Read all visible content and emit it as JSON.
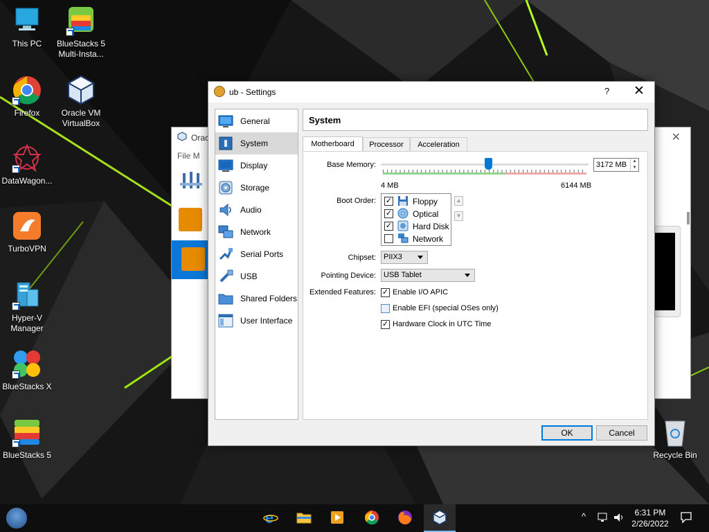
{
  "desktop": {
    "icons": [
      {
        "label": "This PC"
      },
      {
        "label": "BlueStacks 5 Multi-Insta..."
      },
      {
        "label": "Firefox"
      },
      {
        "label": "Oracle VM VirtualBox"
      },
      {
        "label": "DataWagon..."
      },
      {
        "label": "TurboVPN"
      },
      {
        "label": "Hyper-V Manager"
      },
      {
        "label": "BlueStacks X"
      },
      {
        "label": "BlueStacks 5"
      },
      {
        "label": "Recycle Bin"
      }
    ]
  },
  "manager": {
    "title": "Orac",
    "menu": "File   M"
  },
  "dialog": {
    "title": "ub - Settings",
    "help": "?",
    "close": "✕",
    "sidebar": [
      {
        "label": "General",
        "icon": "general-icon"
      },
      {
        "label": "System",
        "icon": "system-icon",
        "selected": true
      },
      {
        "label": "Display",
        "icon": "display-icon"
      },
      {
        "label": "Storage",
        "icon": "storage-icon"
      },
      {
        "label": "Audio",
        "icon": "audio-icon"
      },
      {
        "label": "Network",
        "icon": "network-icon"
      },
      {
        "label": "Serial Ports",
        "icon": "serial-ports-icon"
      },
      {
        "label": "USB",
        "icon": "usb-icon"
      },
      {
        "label": "Shared Folders",
        "icon": "shared-folders-icon"
      },
      {
        "label": "User Interface",
        "icon": "user-interface-icon"
      }
    ],
    "section_title": "System",
    "tabs": [
      {
        "label": "Motherboard",
        "active": true
      },
      {
        "label": "Processor"
      },
      {
        "label": "Acceleration"
      }
    ],
    "motherboard": {
      "base_memory_label": "Base Memory:",
      "base_memory_value": "3172 MB",
      "base_memory_mb": 3172,
      "memory_min_label": "4 MB",
      "memory_max_label": "6144 MB",
      "memory_min_mb": 4,
      "memory_max_mb": 6144,
      "boot_order_label": "Boot Order:",
      "boot_order": [
        {
          "label": "Floppy",
          "checked": true,
          "icon": "floppy-icon"
        },
        {
          "label": "Optical",
          "checked": true,
          "icon": "optical-disc-icon"
        },
        {
          "label": "Hard Disk",
          "checked": true,
          "icon": "hard-disk-icon"
        },
        {
          "label": "Network",
          "checked": false,
          "icon": "network-icon"
        }
      ],
      "move_up": "▲",
      "move_down": "▼",
      "chipset_label": "Chipset:",
      "chipset_value": "PIIX3",
      "pointing_label": "Pointing Device:",
      "pointing_value": "USB Tablet",
      "extended_label": "Extended Features:",
      "features": [
        {
          "label": "Enable I/O APIC",
          "checked": true
        },
        {
          "label": "Enable EFI (special OSes only)",
          "checked": false
        },
        {
          "label": "Hardware Clock in UTC Time",
          "checked": true
        }
      ]
    },
    "ok": "OK",
    "cancel": "Cancel",
    "check_mark": "✓"
  },
  "taskbar": {
    "clock_time": "6:31 PM",
    "clock_date": "2/26/2022",
    "chevron": "^",
    "apps": [
      "internet-explorer-icon",
      "file-explorer-icon",
      "media-player-icon",
      "chrome-icon",
      "firefox-icon",
      "virtualbox-icon"
    ]
  },
  "colors": {
    "accent": "#0078d7",
    "selection": "#d9d9d9",
    "slider_green": "#8fd48f",
    "slider_red": "#f0a8a8"
  }
}
